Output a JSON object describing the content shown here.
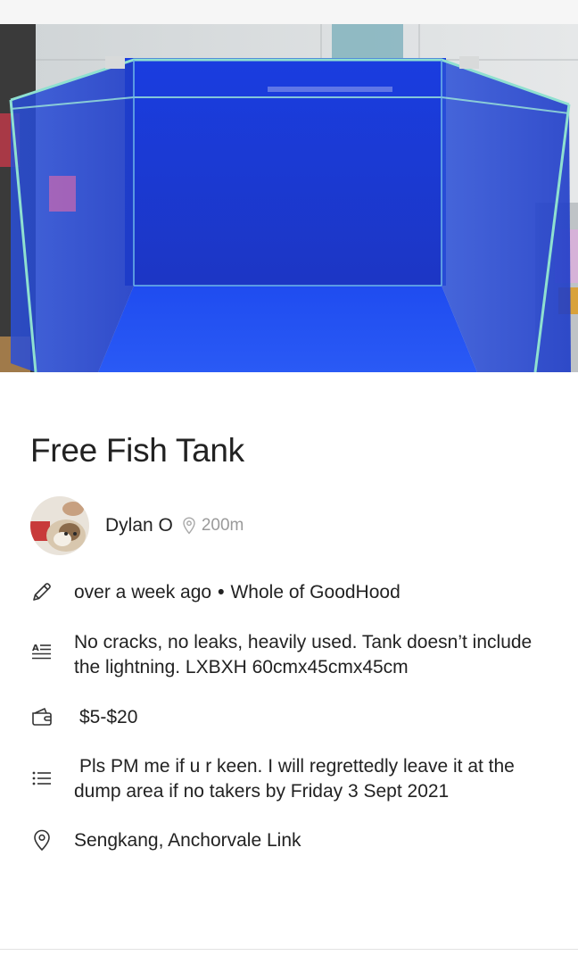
{
  "listing": {
    "title": "Free Fish Tank",
    "photo_alt": "Glass fish tank with blue background"
  },
  "seller": {
    "name": "Dylan O",
    "distance": "200m"
  },
  "details": {
    "posted": "over a week ago",
    "separator": "•",
    "scope": "Whole of GoodHood",
    "description": "No cracks, no leaks, heavily used. Tank doesn’t include the lightning. LXBXH 60cmx45cmx45cm",
    "price": "$5-$20",
    "notes": "Pls PM me if u r keen. I will regrettedly leave it at the dump area if no takers by Friday 3 Sept 2021",
    "location": "Sengkang, Anchorvale Link"
  },
  "icons": {
    "posted": "pencil-icon",
    "description": "description-icon",
    "price": "wallet-icon",
    "notes": "list-icon",
    "location": "location-pin-icon",
    "distance": "location-pin-icon"
  },
  "colors": {
    "tank_blue": "#1f3fd6",
    "text": "#222222",
    "muted": "#9a9a9a"
  }
}
